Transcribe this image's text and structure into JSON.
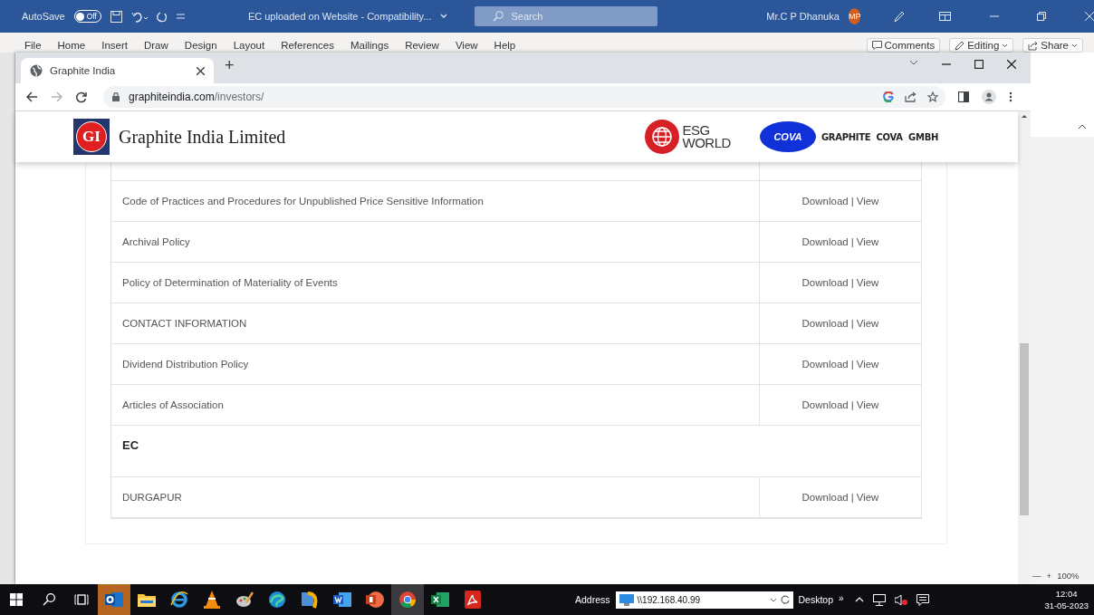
{
  "word": {
    "autosave": {
      "label": "AutoSave",
      "on": false,
      "state_text": "Off"
    },
    "document_title": "EC uploaded on Website - Compatibility...",
    "search": {
      "placeholder": "Search"
    },
    "user": {
      "name": "Mr.C P Dhanuka",
      "initials": "MP"
    },
    "menu": [
      "File",
      "Home",
      "Insert",
      "Draw",
      "Design",
      "Layout",
      "References",
      "Mailings",
      "Review",
      "View",
      "Help"
    ],
    "actions": [
      {
        "kind": "comments",
        "label": "Comments"
      },
      {
        "kind": "editing",
        "label": "Editing"
      },
      {
        "kind": "share",
        "label": "Share"
      }
    ],
    "zoom": {
      "minus": "—",
      "plus": "+",
      "value": "100%"
    }
  },
  "browser": {
    "tabs": [
      {
        "title": "Graphite India",
        "selected": true
      }
    ],
    "new_tab": "+",
    "url": {
      "host": "graphiteindia.com",
      "path": "/investors/"
    }
  },
  "site": {
    "logo_text": "GI",
    "company": "Graphite India Limited",
    "esg": {
      "line_1": "ESG",
      "line_2": "WORLD"
    },
    "cova": {
      "logo_text": "COVA",
      "name": "GRAPHITE  COVA  GMBH"
    }
  },
  "documents": {
    "separator": "|",
    "rows": [
      {
        "kind": "document",
        "title": "Code of Practices and Procedures for Unpublished Price Sensitive Information",
        "download": "Download",
        "view": "View"
      },
      {
        "kind": "document",
        "title": "Archival Policy",
        "download": "Download",
        "view": "View"
      },
      {
        "kind": "document",
        "title": "Policy of Determination of Materiality of Events",
        "download": "Download",
        "view": "View"
      },
      {
        "kind": "document",
        "title": "CONTACT INFORMATION",
        "download": "Download",
        "view": "View"
      },
      {
        "kind": "document",
        "title": "Dividend Distribution Policy",
        "download": "Download",
        "view": "View"
      },
      {
        "kind": "document",
        "title": "Articles of Association",
        "download": "Download",
        "view": "View"
      },
      {
        "kind": "heading",
        "title": "EC"
      },
      {
        "kind": "document",
        "title": "DURGAPUR",
        "download": "Download",
        "view": "View"
      }
    ]
  },
  "taskbar": {
    "apps": [
      {
        "kind": "mail",
        "selected": false,
        "alert": true
      },
      {
        "kind": "folder",
        "selected": false,
        "alert": false
      },
      {
        "kind": "ie",
        "selected": false,
        "alert": false
      },
      {
        "kind": "cone",
        "selected": false,
        "alert": false
      },
      {
        "kind": "paint",
        "selected": false,
        "alert": false
      },
      {
        "kind": "edge",
        "selected": false,
        "alert": false
      },
      {
        "kind": "media",
        "selected": false,
        "alert": false
      },
      {
        "kind": "word",
        "selected": false,
        "alert": false
      },
      {
        "kind": "powerpoint",
        "selected": false,
        "alert": false
      },
      {
        "kind": "chrome",
        "selected": true,
        "alert": false
      },
      {
        "kind": "excel",
        "selected": false,
        "alert": false
      },
      {
        "kind": "pdf",
        "selected": false,
        "alert": false
      }
    ],
    "address": {
      "label": "Address",
      "value": "\\\\192.168.40.99"
    },
    "desktop": "Desktop",
    "more": "»",
    "clock": {
      "time": "12:04",
      "date": "31-05-2023"
    }
  }
}
